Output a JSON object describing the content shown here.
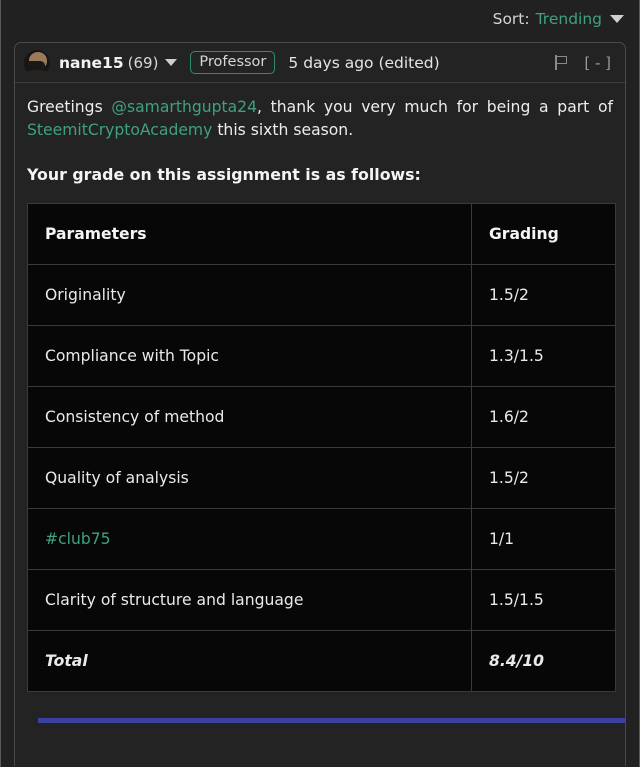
{
  "sort_bar": {
    "label": "Sort:",
    "value": "Trending",
    "caret_icon": "chevron-down-icon"
  },
  "comment": {
    "avatar_alt": "nane15 profile photo",
    "username": "nane15",
    "reputation": "(69)",
    "role_badge": "Professor",
    "timestamp": "5 days ago (edited)",
    "flag_icon": "flag-icon",
    "collapse_toggle": "[ - ]",
    "body": {
      "greeting_pre": "Greetings ",
      "mention": "@samarthgupta24",
      "greeting_mid": ", thank you very much for being a part of ",
      "community_link": "SteemitCryptoAcademy",
      "greeting_post": " this sixth season.",
      "grade_heading": "Your grade on this assignment is as follows:"
    },
    "grade_table": {
      "headers": [
        "Parameters",
        "Grading"
      ],
      "rows": [
        {
          "parameter": "Originality",
          "grading": "1.5/2",
          "is_link": false,
          "is_total": false
        },
        {
          "parameter": "Compliance with Topic",
          "grading": "1.3/1.5",
          "is_link": false,
          "is_total": false
        },
        {
          "parameter": "Consistency of method",
          "grading": "1.6/2",
          "is_link": false,
          "is_total": false
        },
        {
          "parameter": "Quality of analysis",
          "grading": "1.5/2",
          "is_link": false,
          "is_total": false
        },
        {
          "parameter": "#club75",
          "grading": "1/1",
          "is_link": true,
          "is_total": false
        },
        {
          "parameter": "Clarity of structure and language",
          "grading": "1.5/1.5",
          "is_link": false,
          "is_total": false
        },
        {
          "parameter": "Total",
          "grading": "8.4/10",
          "is_link": false,
          "is_total": true
        }
      ]
    }
  },
  "colors": {
    "page_background": "#212121",
    "card_background": "#232323",
    "table_background": "#070707",
    "accent_green": "#3ea27e",
    "divider_blue": "#3b41a0",
    "border_gray": "#3a3a3a"
  }
}
